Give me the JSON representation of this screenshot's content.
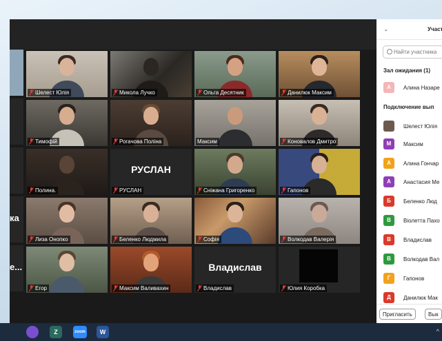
{
  "panel": {
    "title": "Участ",
    "search_placeholder": "Найти участника",
    "waiting_room": "Зал ожидания (1)",
    "waiting": [
      {
        "initial": "А",
        "name": "Алина Назаре",
        "color": "#f4b6b6"
      }
    ],
    "connected": "Подключение вып",
    "participants": [
      {
        "initial": "",
        "name": "Шелест Юлія",
        "color": "#6b5b4e"
      },
      {
        "initial": "M",
        "name": "Максим",
        "color": "#8e3fb5"
      },
      {
        "initial": "A",
        "name": "Алина Гончар",
        "color": "#f2a21c"
      },
      {
        "initial": "A",
        "name": "Анастасия Ме",
        "color": "#8e3fb5"
      },
      {
        "initial": "Б",
        "name": "Беленко Люд",
        "color": "#d93a2b"
      },
      {
        "initial": "В",
        "name": "Віолетта Пахо",
        "color": "#2e9a3e"
      },
      {
        "initial": "В",
        "name": "Владислав",
        "color": "#d93a2b"
      },
      {
        "initial": "В",
        "name": "Волкодав Вал",
        "color": "#2e9a3e"
      },
      {
        "initial": "Г",
        "name": "Гапонов",
        "color": "#f2a21c"
      },
      {
        "initial": "Д",
        "name": "Данилюк Мак",
        "color": "#d93a2b"
      }
    ],
    "invite_button": "Пригласить",
    "next_button": "Вык"
  },
  "gallery": {
    "row1": [
      "Шелест Юлія",
      "Микола Лучко",
      "Ольга Десятник",
      "Данилюк Максим"
    ],
    "row2": [
      "Тимофій",
      "Рогачова Поліна",
      "Максим",
      "Коновалов Дмитро"
    ],
    "row3": [
      "Полина.",
      "РУСЛАН",
      "Сніжана Григоренко",
      "Гапонов"
    ],
    "row4": [
      "Лиза Онопко",
      "Беленко Людмила",
      "Софія",
      "Волкодав Валерія"
    ],
    "row5": [
      "Егор",
      "Максим Валивахин",
      "Владислав",
      "Юлия Коробка"
    ],
    "big_ruslan": "РУСЛАН",
    "big_vladislav": "Владислав",
    "cut_row4": "ка",
    "cut_row5": "е..."
  },
  "taskbar": {
    "icons": [
      "viber-icon",
      "zello-icon",
      "zoom-icon",
      "word-icon"
    ],
    "zoom_label": "zoom",
    "word_label": "W",
    "tray": "^"
  }
}
